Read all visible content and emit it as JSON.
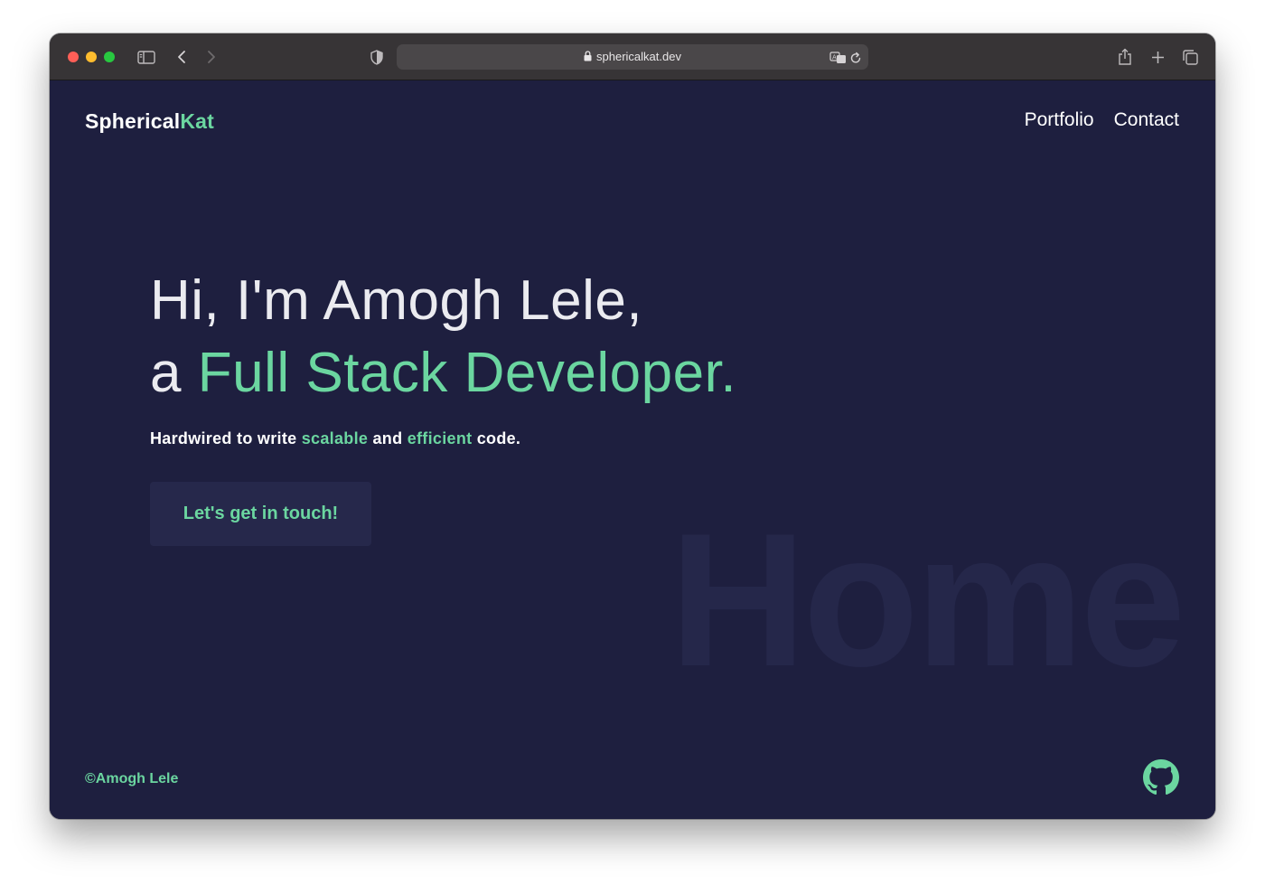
{
  "browser": {
    "url": "sphericalkat.dev",
    "icons": {
      "sidebar": "sidebar-icon",
      "back": "chevron-left-icon",
      "forward": "chevron-right-icon",
      "shield": "shield-icon",
      "translate": "translate-icon",
      "reload": "reload-icon",
      "share": "share-icon",
      "new_tab": "plus-icon",
      "tabs": "tab-overview-icon"
    }
  },
  "site": {
    "logo_main": "Spherical",
    "logo_accent": "Kat",
    "nav": [
      {
        "label": "Portfolio"
      },
      {
        "label": "Contact"
      }
    ],
    "hero": {
      "line1": "Hi, I'm Amogh Lele,",
      "line2_prefix": "a ",
      "line2_accent": "Full Stack Developer."
    },
    "tagline": {
      "part1": "Hardwired to write ",
      "accent1": "scalable",
      "part2": " and ",
      "accent2": "efficient",
      "part3": " code."
    },
    "cta_label": "Let's get in touch!",
    "watermark": "Home",
    "footer_copy": "©Amogh Lele",
    "footer_icon": "github-icon"
  },
  "colors": {
    "background": "#1e1f3f",
    "accent": "#6bd6a0",
    "text": "#ebebf0",
    "button_bg": "#26284b",
    "watermark": "#25274a"
  }
}
